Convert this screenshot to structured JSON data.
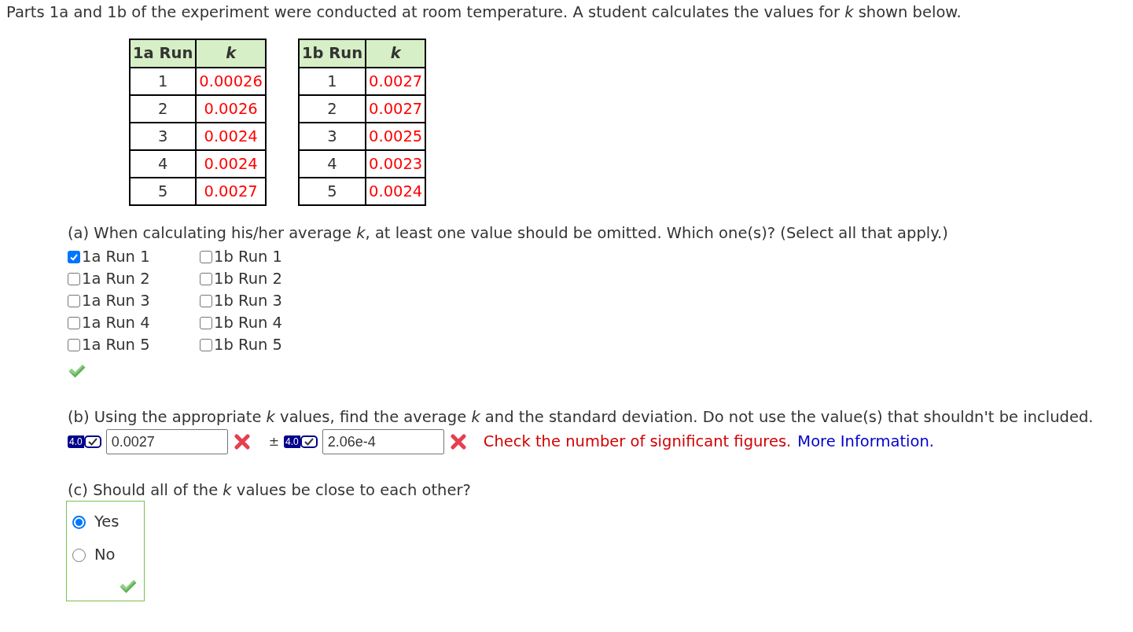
{
  "intro": "Parts 1a and 1b of the experiment were conducted at room temperature. A student calculates the values for *k* shown below.",
  "tables": [
    {
      "columns": [
        "1a Run",
        "k"
      ],
      "rows": [
        [
          "1",
          "0.00026"
        ],
        [
          "2",
          "0.0026"
        ],
        [
          "3",
          "0.0024"
        ],
        [
          "4",
          "0.0024"
        ],
        [
          "5",
          "0.0027"
        ]
      ]
    },
    {
      "columns": [
        "1b Run",
        "k"
      ],
      "rows": [
        [
          "1",
          "0.0027"
        ],
        [
          "2",
          "0.0027"
        ],
        [
          "3",
          "0.0025"
        ],
        [
          "4",
          "0.0023"
        ],
        [
          "5",
          "0.0024"
        ]
      ]
    }
  ],
  "part_a": {
    "question": "(a) When calculating his/her average *k*, at least one value should be omitted. Which one(s)? (Select all that apply.)",
    "option_columns": [
      [
        {
          "label": "1a Run 1",
          "checked": true
        },
        {
          "label": "1a Run 2",
          "checked": false
        },
        {
          "label": "1a Run 3",
          "checked": false
        },
        {
          "label": "1a Run 4",
          "checked": false
        },
        {
          "label": "1a Run 5",
          "checked": false
        }
      ],
      [
        {
          "label": "1b Run 1",
          "checked": false
        },
        {
          "label": "1b Run 2",
          "checked": false
        },
        {
          "label": "1b Run 3",
          "checked": false
        },
        {
          "label": "1b Run 4",
          "checked": false
        },
        {
          "label": "1b Run 5",
          "checked": false
        }
      ]
    ],
    "correct": true
  },
  "part_b": {
    "question": "(b) Using the appropriate *k* values, find the average *k* and the standard deviation. Do not use the value(s) that shouldn't be included.",
    "fields": [
      {
        "badge": "4.0",
        "value": "0.0027",
        "correct": false
      },
      {
        "badge": "4.0",
        "value": "2.06e-4",
        "correct": false
      }
    ],
    "separator": "±",
    "feedback": "Check the number of significant figures.",
    "link": "More Information."
  },
  "part_c": {
    "question": "(c) Should all of the *k* values be close to each other?",
    "options": [
      {
        "label": "Yes",
        "selected": true
      },
      {
        "label": "No",
        "selected": false
      }
    ],
    "correct": true
  }
}
